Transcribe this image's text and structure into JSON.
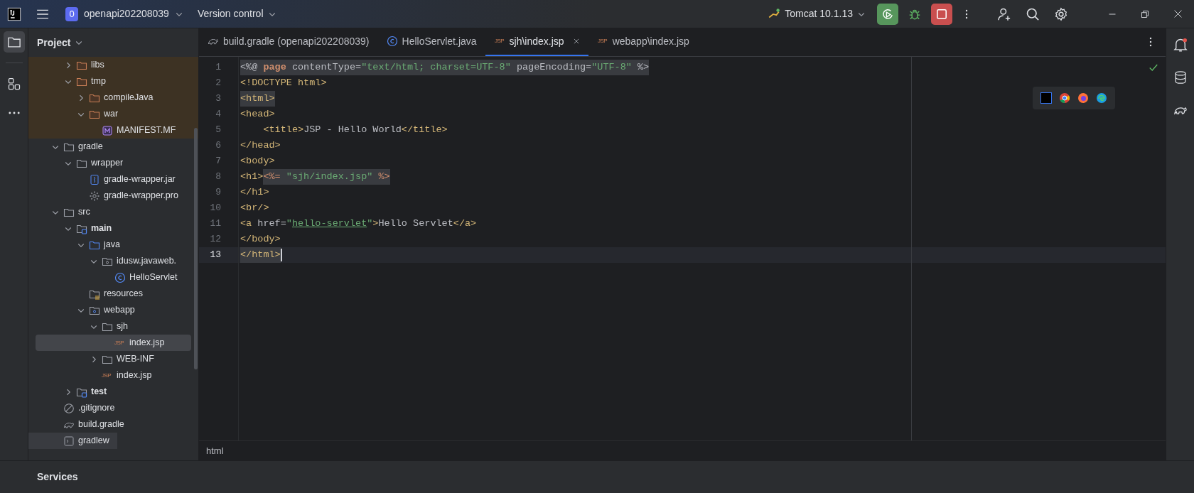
{
  "title_bar": {
    "project_badge": "0",
    "project": "openapi202208039",
    "vcs": "Version control",
    "run_config": "Tomcat 10.1.13"
  },
  "tool_window": {
    "title": "Project"
  },
  "tree": [
    {
      "excluded": true,
      "children": [
        {
          "label": "libs",
          "kind": "folder",
          "expanded": false,
          "selected": false
        },
        {
          "label": "tmp",
          "kind": "folder",
          "expanded": true,
          "selected": false,
          "children": [
            {
              "label": "compileJava",
              "kind": "folder",
              "expanded": false,
              "selected": false
            },
            {
              "label": "war",
              "kind": "folder",
              "expanded": true,
              "selected": false,
              "children": [
                {
                  "label": "MANIFEST.MF",
                  "kind": "manifest",
                  "selected": false
                }
              ]
            }
          ]
        }
      ]
    },
    {
      "label": "gradle",
      "kind": "folder",
      "expanded": true,
      "selected": false,
      "children": [
        {
          "label": "wrapper",
          "kind": "folder",
          "expanded": true,
          "selected": false,
          "children": [
            {
              "label": "gradle-wrapper.jar",
              "kind": "archive",
              "selected": false
            },
            {
              "label": "gradle-wrapper.pro",
              "kind": "settings",
              "selected": false
            }
          ]
        }
      ]
    },
    {
      "label": "src",
      "kind": "folder",
      "expanded": true,
      "selected": false,
      "children": [
        {
          "label": "main",
          "kind": "source-set",
          "expanded": true,
          "selected": false,
          "children": [
            {
              "label": "java",
              "kind": "source-root",
              "expanded": true,
              "selected": false,
              "children": [
                {
                  "label": "idusw.javaweb.",
                  "kind": "package",
                  "expanded": true,
                  "selected": false,
                  "children": [
                    {
                      "label": "HelloServlet",
                      "kind": "class",
                      "selected": false
                    }
                  ]
                }
              ]
            },
            {
              "label": "resources",
              "kind": "resources",
              "selected": false
            },
            {
              "label": "webapp",
              "kind": "web",
              "expanded": true,
              "selected": false,
              "children": [
                {
                  "label": "sjh",
                  "kind": "folder",
                  "expanded": true,
                  "selected": false,
                  "children": [
                    {
                      "label": "index.jsp",
                      "kind": "jsp",
                      "icon_text": "JSP",
                      "selected": true
                    }
                  ]
                },
                {
                  "label": "WEB-INF",
                  "kind": "folder",
                  "expanded": false,
                  "selected": false
                },
                {
                  "label": "index.jsp",
                  "kind": "jsp",
                  "icon_text": "JSP",
                  "selected": false
                }
              ]
            }
          ]
        },
        {
          "label": "test",
          "kind": "source-set",
          "expanded": false,
          "selected": false
        }
      ]
    },
    {
      "label": ".gitignore",
      "kind": "ignore",
      "selected": false
    },
    {
      "label": "build.gradle",
      "kind": "gradle",
      "selected": false
    },
    {
      "label": "gradlew",
      "kind": "script",
      "selected": false,
      "highlighted": true
    }
  ],
  "tabs": [
    {
      "label": "build.gradle (openapi202208039)",
      "kind": "gradle",
      "selected": false
    },
    {
      "label": "HelloServlet.java",
      "kind": "class",
      "selected": false
    },
    {
      "label": "sjh\\index.jsp",
      "kind": "jsp",
      "icon_text": "JSP",
      "selected": true
    },
    {
      "label": "webapp\\index.jsp",
      "kind": "jsp",
      "icon_text": "JSP",
      "selected": false
    }
  ],
  "editor": {
    "lines": [
      {
        "number": "1",
        "current": false,
        "segments": [
          {
            "kind": "plain",
            "text": "<%@ ",
            "highlighted": true
          },
          {
            "kind": "keyword",
            "text": "page",
            "highlighted": true
          },
          {
            "kind": "plain",
            "text": " contentType=",
            "highlighted": true
          },
          {
            "kind": "string",
            "text": "\"text/html; charset=UTF-8\"",
            "highlighted": true
          },
          {
            "kind": "plain",
            "text": " pageEncoding=",
            "highlighted": true
          },
          {
            "kind": "string",
            "text": "\"UTF-8\"",
            "highlighted": true
          },
          {
            "kind": "plain",
            "text": " %>",
            "highlighted": true
          }
        ]
      },
      {
        "number": "2",
        "current": false,
        "segments": [
          {
            "kind": "tag",
            "text": "<!DOCTYPE html>",
            "highlighted": false
          }
        ]
      },
      {
        "number": "3",
        "current": false,
        "segments": [
          {
            "kind": "tag",
            "text": "<html>",
            "highlighted": true
          }
        ]
      },
      {
        "number": "4",
        "current": false,
        "segments": [
          {
            "kind": "tag",
            "text": "<head>",
            "highlighted": false
          }
        ]
      },
      {
        "number": "5",
        "current": false,
        "segments": [
          {
            "kind": "tag",
            "text": "    <title>",
            "highlighted": false
          },
          {
            "kind": "plain",
            "text": "JSP - Hello World",
            "highlighted": false
          },
          {
            "kind": "tag",
            "text": "</title>",
            "highlighted": false
          }
        ]
      },
      {
        "number": "6",
        "current": false,
        "segments": [
          {
            "kind": "tag",
            "text": "</head>",
            "highlighted": false
          }
        ]
      },
      {
        "number": "7",
        "current": false,
        "segments": [
          {
            "kind": "tag",
            "text": "<body>",
            "highlighted": false
          }
        ]
      },
      {
        "number": "8",
        "current": false,
        "segments": [
          {
            "kind": "tag",
            "text": "<h1>",
            "highlighted": false
          },
          {
            "kind": "jsp",
            "text": "<%= ",
            "highlighted": true
          },
          {
            "kind": "string",
            "text": "\"sjh/index.jsp\"",
            "highlighted": true
          },
          {
            "kind": "jsp",
            "text": " %>",
            "highlighted": true
          }
        ]
      },
      {
        "number": "9",
        "current": false,
        "segments": [
          {
            "kind": "tag",
            "text": "</h1>",
            "highlighted": false
          }
        ]
      },
      {
        "number": "10",
        "current": false,
        "segments": [
          {
            "kind": "tag",
            "text": "<br/>",
            "highlighted": false
          }
        ]
      },
      {
        "number": "11",
        "current": false,
        "segments": [
          {
            "kind": "tag",
            "text": "<a",
            "highlighted": false
          },
          {
            "kind": "plain",
            "text": " href=",
            "highlighted": false
          },
          {
            "kind": "string",
            "text": "\"",
            "highlighted": false
          },
          {
            "kind": "link",
            "text": "hello-servlet",
            "highlighted": false
          },
          {
            "kind": "string",
            "text": "\"",
            "highlighted": false
          },
          {
            "kind": "tag",
            "text": ">",
            "highlighted": false
          },
          {
            "kind": "plain",
            "text": "Hello Servlet",
            "highlighted": false
          },
          {
            "kind": "tag",
            "text": "</a>",
            "highlighted": false
          }
        ]
      },
      {
        "number": "12",
        "current": false,
        "segments": [
          {
            "kind": "tag",
            "text": "</body>",
            "highlighted": false
          }
        ]
      },
      {
        "number": "13",
        "current": true,
        "segments": [
          {
            "kind": "tag",
            "text": "</html>",
            "highlighted": true
          }
        ]
      }
    ],
    "breadcrumb": "html"
  },
  "bottom_panel": {
    "title": "Services"
  }
}
